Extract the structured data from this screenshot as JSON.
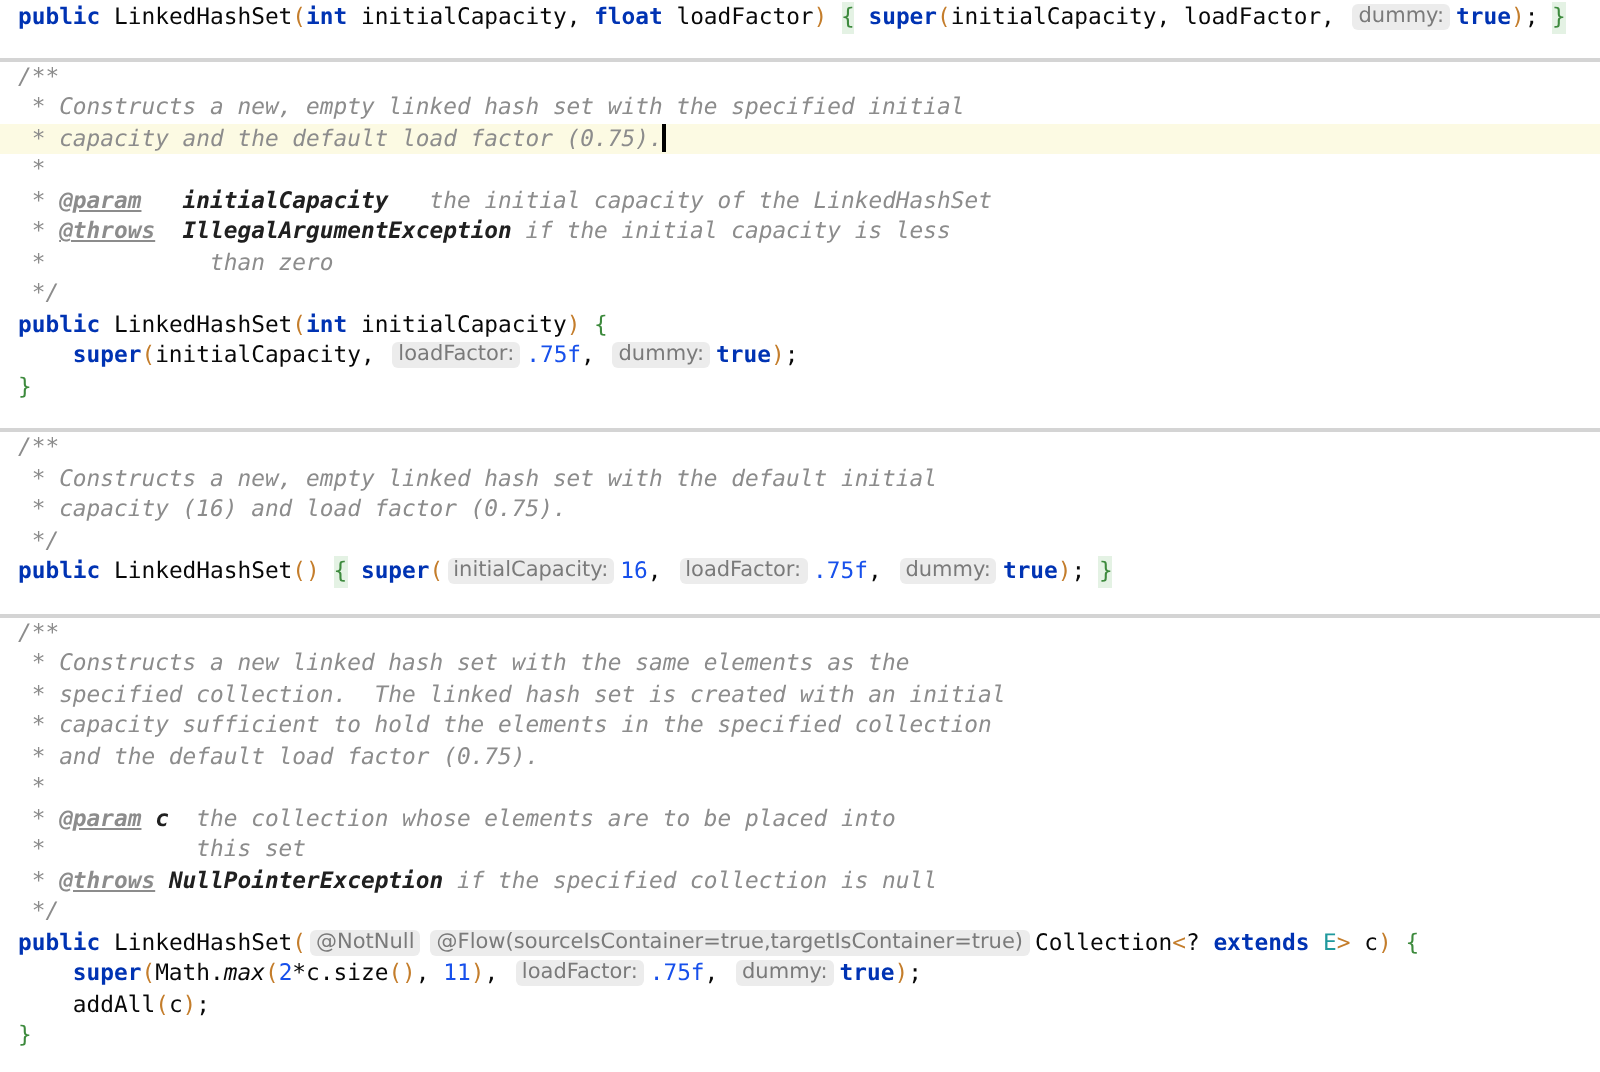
{
  "blocks": [
    {
      "lines": [
        {
          "current": false,
          "indent": false,
          "tokens": [
            {
              "kind": "kw",
              "text": "public"
            },
            {
              "kind": "plain",
              "text": " LinkedHashSet"
            },
            {
              "kind": "paren",
              "text": "("
            },
            {
              "kind": "kw",
              "text": "int"
            },
            {
              "kind": "plain",
              "text": " initialCapacity, "
            },
            {
              "kind": "kw",
              "text": "float"
            },
            {
              "kind": "plain",
              "text": " loadFactor"
            },
            {
              "kind": "paren",
              "text": ") "
            },
            {
              "kind": "fold",
              "text": "{"
            },
            {
              "kind": "kw",
              "text": " super"
            },
            {
              "kind": "paren",
              "text": "("
            },
            {
              "kind": "plain",
              "text": "initialCapacity, loadFactor, "
            },
            {
              "kind": "hint",
              "text": "dummy:"
            },
            {
              "kind": "kw",
              "text": "true"
            },
            {
              "kind": "paren",
              "text": ")"
            },
            {
              "kind": "plain",
              "text": "; "
            },
            {
              "kind": "fold",
              "text": "}"
            }
          ]
        }
      ]
    },
    {
      "lines": [
        {
          "current": false,
          "indent": false,
          "tokens": [
            {
              "kind": "comment",
              "text": "/**"
            }
          ]
        },
        {
          "current": false,
          "indent": false,
          "tokens": [
            {
              "kind": "comment",
              "text": " * Constructs a new, empty linked hash set with the specified initial"
            }
          ]
        },
        {
          "current": true,
          "indent": false,
          "tokens": [
            {
              "kind": "comment",
              "text": " * capacity and the default load factor (0.75)."
            }
          ]
        },
        {
          "current": false,
          "indent": false,
          "tokens": [
            {
              "kind": "comment",
              "text": " *"
            }
          ]
        },
        {
          "current": false,
          "indent": false,
          "tokens": [
            {
              "kind": "comment",
              "text": " * "
            },
            {
              "kind": "doctag",
              "text": "@param"
            },
            {
              "kind": "docref",
              "text": "   initialCapacity"
            },
            {
              "kind": "comment",
              "text": "   the initial capacity of the LinkedHashSet"
            }
          ]
        },
        {
          "current": false,
          "indent": false,
          "tokens": [
            {
              "kind": "comment",
              "text": " * "
            },
            {
              "kind": "doctag",
              "text": "@throws"
            },
            {
              "kind": "docref",
              "text": "  IllegalArgumentException"
            },
            {
              "kind": "comment",
              "text": " if the initial capacity is less"
            }
          ]
        },
        {
          "current": false,
          "indent": false,
          "tokens": [
            {
              "kind": "comment",
              "text": " *            than zero"
            }
          ]
        },
        {
          "current": false,
          "indent": false,
          "tokens": [
            {
              "kind": "comment",
              "text": " */"
            }
          ]
        },
        {
          "current": false,
          "indent": false,
          "tokens": [
            {
              "kind": "kw",
              "text": "public"
            },
            {
              "kind": "plain",
              "text": " LinkedHashSet"
            },
            {
              "kind": "paren",
              "text": "("
            },
            {
              "kind": "kw",
              "text": "int"
            },
            {
              "kind": "plain",
              "text": " initialCapacity"
            },
            {
              "kind": "paren",
              "text": ")"
            },
            {
              "kind": "brace",
              "text": " {"
            }
          ]
        },
        {
          "current": false,
          "indent": true,
          "tokens": [
            {
              "kind": "kw",
              "text": "super"
            },
            {
              "kind": "paren",
              "text": "("
            },
            {
              "kind": "plain",
              "text": "initialCapacity, "
            },
            {
              "kind": "hint",
              "text": "loadFactor:"
            },
            {
              "kind": "num",
              "text": ".75f"
            },
            {
              "kind": "plain",
              "text": ", "
            },
            {
              "kind": "hint",
              "text": "dummy:"
            },
            {
              "kind": "kw",
              "text": "true"
            },
            {
              "kind": "paren",
              "text": ")"
            },
            {
              "kind": "plain",
              "text": ";"
            }
          ]
        },
        {
          "current": false,
          "indent": false,
          "tokens": [
            {
              "kind": "brace",
              "text": "}"
            }
          ]
        }
      ]
    },
    {
      "lines": [
        {
          "current": false,
          "indent": false,
          "tokens": [
            {
              "kind": "comment",
              "text": "/**"
            }
          ]
        },
        {
          "current": false,
          "indent": false,
          "tokens": [
            {
              "kind": "comment",
              "text": " * Constructs a new, empty linked hash set with the default initial"
            }
          ]
        },
        {
          "current": false,
          "indent": false,
          "tokens": [
            {
              "kind": "comment",
              "text": " * capacity (16) and load factor (0.75)."
            }
          ]
        },
        {
          "current": false,
          "indent": false,
          "tokens": [
            {
              "kind": "comment",
              "text": " */"
            }
          ]
        },
        {
          "current": false,
          "indent": false,
          "tokens": [
            {
              "kind": "kw",
              "text": "public"
            },
            {
              "kind": "plain",
              "text": " LinkedHashSet"
            },
            {
              "kind": "paren",
              "text": "() "
            },
            {
              "kind": "fold",
              "text": "{"
            },
            {
              "kind": "kw",
              "text": " super"
            },
            {
              "kind": "paren",
              "text": "("
            },
            {
              "kind": "hint",
              "text": "initialCapacity:"
            },
            {
              "kind": "num",
              "text": "16"
            },
            {
              "kind": "plain",
              "text": ", "
            },
            {
              "kind": "hint",
              "text": "loadFactor:"
            },
            {
              "kind": "num",
              "text": ".75f"
            },
            {
              "kind": "plain",
              "text": ", "
            },
            {
              "kind": "hint",
              "text": "dummy:"
            },
            {
              "kind": "kw",
              "text": "true"
            },
            {
              "kind": "paren",
              "text": ")"
            },
            {
              "kind": "plain",
              "text": "; "
            },
            {
              "kind": "fold",
              "text": "}"
            }
          ]
        }
      ]
    },
    {
      "lines": [
        {
          "current": false,
          "indent": false,
          "tokens": [
            {
              "kind": "comment",
              "text": "/**"
            }
          ]
        },
        {
          "current": false,
          "indent": false,
          "tokens": [
            {
              "kind": "comment",
              "text": " * Constructs a new linked hash set with the same elements as the"
            }
          ]
        },
        {
          "current": false,
          "indent": false,
          "tokens": [
            {
              "kind": "comment",
              "text": " * specified collection.  The linked hash set is created with an initial"
            }
          ]
        },
        {
          "current": false,
          "indent": false,
          "tokens": [
            {
              "kind": "comment",
              "text": " * capacity sufficient to hold the elements in the specified collection"
            }
          ]
        },
        {
          "current": false,
          "indent": false,
          "tokens": [
            {
              "kind": "comment",
              "text": " * and the default load factor (0.75)."
            }
          ]
        },
        {
          "current": false,
          "indent": false,
          "tokens": [
            {
              "kind": "comment",
              "text": " *"
            }
          ]
        },
        {
          "current": false,
          "indent": false,
          "tokens": [
            {
              "kind": "comment",
              "text": " * "
            },
            {
              "kind": "doctag",
              "text": "@param"
            },
            {
              "kind": "docref",
              "text": " c"
            },
            {
              "kind": "comment",
              "text": "  the collection whose elements are to be placed into"
            }
          ]
        },
        {
          "current": false,
          "indent": false,
          "tokens": [
            {
              "kind": "comment",
              "text": " *           this set"
            }
          ]
        },
        {
          "current": false,
          "indent": false,
          "tokens": [
            {
              "kind": "comment",
              "text": " * "
            },
            {
              "kind": "doctag",
              "text": "@throws"
            },
            {
              "kind": "docref",
              "text": " NullPointerException"
            },
            {
              "kind": "comment",
              "text": " if the specified collection is null"
            }
          ]
        },
        {
          "current": false,
          "indent": false,
          "tokens": [
            {
              "kind": "comment",
              "text": " */"
            }
          ]
        },
        {
          "current": false,
          "indent": false,
          "tokens": [
            {
              "kind": "kw",
              "text": "public"
            },
            {
              "kind": "plain",
              "text": " LinkedHashSet"
            },
            {
              "kind": "paren",
              "text": "("
            },
            {
              "kind": "hint",
              "text": "@NotNull"
            },
            {
              "kind": "hint",
              "text": "@Flow(sourceIsContainer=true,targetIsContainer=true)"
            },
            {
              "kind": "plain",
              "text": "Collection"
            },
            {
              "kind": "paren",
              "text": "<"
            },
            {
              "kind": "plain",
              "text": "? "
            },
            {
              "kind": "kw",
              "text": "extends"
            },
            {
              "kind": "typeparam",
              "text": " E"
            },
            {
              "kind": "paren",
              "text": ">"
            },
            {
              "kind": "plain",
              "text": " c"
            },
            {
              "kind": "paren",
              "text": ")"
            },
            {
              "kind": "brace",
              "text": " {"
            }
          ]
        },
        {
          "current": false,
          "indent": true,
          "tokens": [
            {
              "kind": "kw",
              "text": "super"
            },
            {
              "kind": "paren",
              "text": "("
            },
            {
              "kind": "plain",
              "text": "Math."
            },
            {
              "kind": "italic",
              "text": "max"
            },
            {
              "kind": "paren",
              "text": "("
            },
            {
              "kind": "num",
              "text": "2"
            },
            {
              "kind": "plain",
              "text": "*c.size"
            },
            {
              "kind": "paren",
              "text": "()"
            },
            {
              "kind": "plain",
              "text": ", "
            },
            {
              "kind": "num",
              "text": "11"
            },
            {
              "kind": "paren",
              "text": ")"
            },
            {
              "kind": "plain",
              "text": ", "
            },
            {
              "kind": "hint",
              "text": "loadFactor:"
            },
            {
              "kind": "num",
              "text": ".75f"
            },
            {
              "kind": "plain",
              "text": ", "
            },
            {
              "kind": "hint",
              "text": "dummy:"
            },
            {
              "kind": "kw",
              "text": "true"
            },
            {
              "kind": "paren",
              "text": ")"
            },
            {
              "kind": "plain",
              "text": ";"
            }
          ]
        },
        {
          "current": false,
          "indent": true,
          "tokens": [
            {
              "kind": "plain",
              "text": "addAll"
            },
            {
              "kind": "paren",
              "text": "("
            },
            {
              "kind": "plain",
              "text": "c"
            },
            {
              "kind": "paren",
              "text": ")"
            },
            {
              "kind": "plain",
              "text": ";"
            }
          ]
        },
        {
          "current": false,
          "indent": false,
          "tokens": [
            {
              "kind": "brace",
              "text": "}"
            }
          ]
        }
      ]
    }
  ]
}
